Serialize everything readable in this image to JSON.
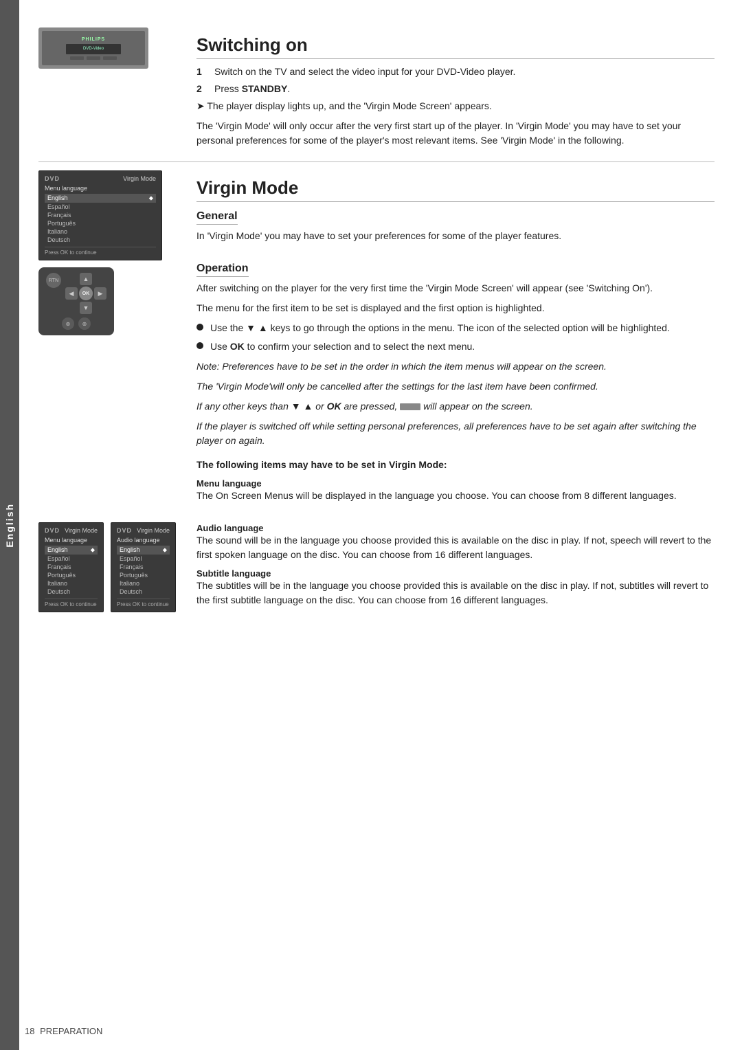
{
  "sidebar": {
    "label": "English"
  },
  "switching_on": {
    "title": "Switching on",
    "steps": [
      {
        "num": "1",
        "text": "Switch on the TV and select the video input for your DVD-Video player."
      },
      {
        "num": "2",
        "text_prefix": "Press ",
        "text_bold": "STANDBY",
        "text_suffix": "."
      }
    ],
    "arrow_note": "The player display lights up, and the 'Virgin Mode Screen' appears.",
    "body": "The 'Virgin Mode' will only occur after the very first start up of the player. In 'Virgin Mode' you may have to set your personal preferences for some of the player's most relevant items. See 'Virgin Mode' in the following."
  },
  "virgin_mode": {
    "title": "Virgin Mode",
    "general": {
      "heading": "General",
      "body": "In 'Virgin Mode' you may have to set your preferences for some of the player features."
    },
    "operation": {
      "heading": "Operation",
      "body1": "After switching on the player for the very first time the 'Virgin Mode Screen' will appear (see 'Switching On').",
      "body2": "The menu for the first item to be set is displayed and the first option is highlighted.",
      "bullets": [
        {
          "text": "Use the ▼ ▲ keys to go through the options in the menu. The icon of the selected option will be highlighted."
        },
        {
          "text": "Use OK to confirm your selection and to select the next menu.",
          "bold_word": "OK"
        }
      ],
      "notes": [
        "Note: Preferences have to be set in the order in which the item menus will appear on the screen.",
        "The 'Virgin Mode'will only be cancelled after the settings for the last item have been confirmed.",
        "If any other keys than ▼ ▲ or OK are pressed,  [image]  will appear on the screen.",
        "If the player is switched off while setting personal preferences, all preferences have to be set again after switching the player on again."
      ]
    }
  },
  "following_items": {
    "heading": "The following items may have to be set in Virgin Mode:",
    "menu_language": {
      "subheading": "Menu language",
      "body": "The On Screen Menus will be displayed in the language you choose. You can choose from 8  different languages."
    },
    "audio_language": {
      "subheading": "Audio language",
      "body": "The sound will be in the language you choose provided this is available on the disc in play. If not, speech will revert to the first spoken language on the disc. You can choose from 16 different languages."
    },
    "subtitle_language": {
      "subheading": "Subtitle language",
      "body": "The subtitles will be in the language you choose provided this is available on the disc in play. If not, subtitles will revert to the first subtitle language on the disc. You can choose from 16 different languages."
    }
  },
  "dvd_menu_1": {
    "logo": "DVD",
    "mode": "Virgin Mode",
    "menu_label": "Menu language",
    "items": [
      "English",
      "Español",
      "Français",
      "Português",
      "Italiano",
      "Deutsch"
    ],
    "selected": "English",
    "footer": "Press OK to continue"
  },
  "dvd_menu_2": {
    "logo": "DVD",
    "mode": "Virgin Mode",
    "menu_label": "Menu language",
    "items": [
      "English",
      "Español",
      "Français",
      "Português",
      "Italiano",
      "Deutsch"
    ],
    "selected": "English",
    "footer": "Press OK to continue"
  },
  "dvd_menu_3": {
    "logo": "DVD",
    "mode": "Virgin Mode",
    "menu_label": "Audio language",
    "items": [
      "English",
      "Español",
      "Français",
      "Português",
      "Italiano",
      "Deutsch"
    ],
    "selected": "English",
    "footer": "Press OK to continue"
  },
  "footer": {
    "page_num": "18",
    "section": "PREPARATION"
  }
}
